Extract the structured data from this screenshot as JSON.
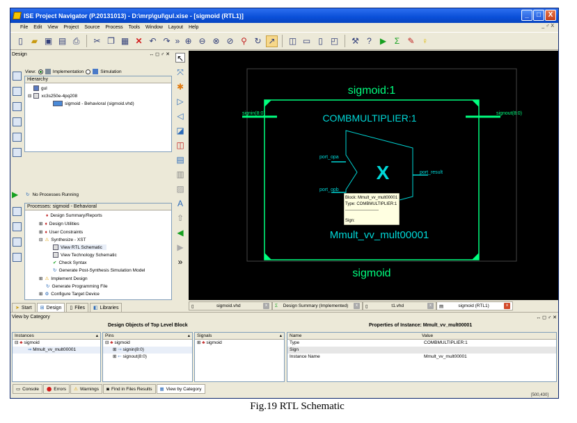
{
  "window": {
    "title": "ISE Project Navigator (P.20131013) - D:\\mrp\\gul\\gul.xise - [sigmoid (RTL1)]",
    "controls": [
      "_",
      "□",
      "X"
    ],
    "doc_controls": "_ ♂ X"
  },
  "menu": [
    "File",
    "Edit",
    "View",
    "Project",
    "Source",
    "Process",
    "Tools",
    "Window",
    "Layout",
    "Help"
  ],
  "design_panel": {
    "title": "Design",
    "view_label": "View:",
    "implementation": "Implementation",
    "simulation": "Simulation",
    "hierarchy_header": "Hierarchy",
    "tree": [
      "gul",
      "xc3s250e-4pq208",
      "sigmoid - Behavioral (sigmoid.vhd)"
    ],
    "no_processes": "No Processes Running",
    "processes_header": "Processes: sigmoid - Behavioral",
    "processes": [
      "Design Summary/Reports",
      "Design Utilities",
      "User Constraints",
      "Synthesize - XST",
      "View RTL Schematic",
      "View Technology Schematic",
      "Check Syntax",
      "Generate Post-Synthesis Simulation Model",
      "Implement Design",
      "Generate Programming File",
      "Configure Target Device"
    ],
    "tabs": [
      "Start",
      "Design",
      "Files",
      "Libraries"
    ]
  },
  "schematic": {
    "outer_title": "sigmoid:1",
    "outer_bottom": "sigmoid",
    "inner_title": "COMBMULTIPLIER:1",
    "inner_bottom": "Mmult_vv_mult00001",
    "operator": "X",
    "pins": {
      "signin": "signin(8:0)",
      "signout": "signout(8:0)",
      "opa": "port_opa",
      "opb": "port_opb",
      "result": "port_result"
    },
    "tooltip": [
      "Block: Mmult_vv_mult00001",
      "Type: COMBMULTIPLIER:1",
      "------------------------",
      "Sign:"
    ],
    "colors": {
      "wire": "#00ff7f",
      "block": "#00d8d8",
      "background": "#000000"
    }
  },
  "doc_tabs": [
    "sigmoid.vhd",
    "Design Summary (Implemented)",
    "t1.vhd",
    "sigmoid (RTL1)"
  ],
  "bottom_panel": {
    "title": "View by Category",
    "left_title": "Design Objects of Top Level Block",
    "right_title": "Properties of Instance: Mmult_vv_mult00001",
    "instances": {
      "header": "Instances",
      "rows": [
        "sigmoid",
        "Mmult_vv_mult00001"
      ]
    },
    "pins": {
      "header": "Pins",
      "rows": [
        "sigmoid",
        "signin(8:0)",
        "signout(8:0)"
      ]
    },
    "signals": {
      "header": "Signals",
      "rows": [
        "sigmoid"
      ]
    },
    "properties": {
      "headers": [
        "Name",
        "Value"
      ],
      "rows": [
        [
          "Type",
          "COMBMULTIPLIER:1"
        ],
        [
          "Sign",
          ""
        ],
        [
          "Instance Name",
          "Mmult_vv_mult00001"
        ]
      ]
    },
    "coords": "[500,430]"
  },
  "status_tabs": [
    "Console",
    "Errors",
    "Warnings",
    "Find in Files Results",
    "View by Category"
  ],
  "caption": "Fig.19 RTL Schematic"
}
